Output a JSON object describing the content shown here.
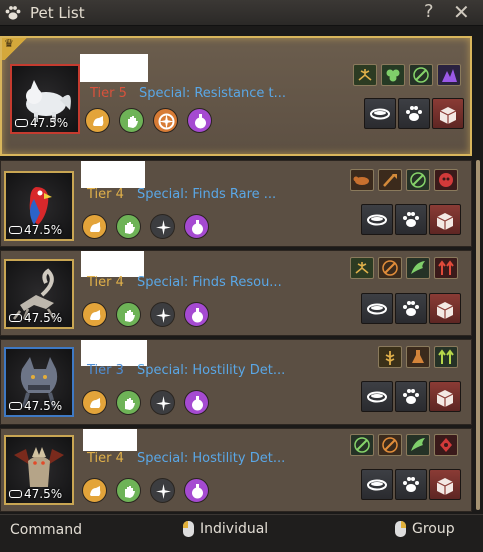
{
  "window": {
    "title": "Pet List",
    "help_glyph": "?",
    "close_glyph": "✕"
  },
  "colors": {
    "tier_gold": "#e0b04a",
    "tier_blue": "#4f8fd6",
    "tier_red": "#d8523c",
    "special_blue": "#5aa7e6"
  },
  "pets": [
    {
      "tier": "Tier 5",
      "tier_color": "#d8523c",
      "special": "Special: Resistance t...",
      "food": "47.5%",
      "frame": "red",
      "portrait": "white-fox-icon",
      "selected": true,
      "skills": [
        "scorpion-icon",
        "clover-icon",
        "pickaxe-icon",
        "purple-crystal-icon"
      ]
    },
    {
      "tier": "Tier 4",
      "tier_color": "#e0b04a",
      "special": "Special: Finds Rare ...",
      "food": "47.5%",
      "frame": "gold",
      "portrait": "red-parrot-icon",
      "selected": false,
      "skills": [
        "beast-icon",
        "shovel-icon",
        "pickaxe-icon",
        "red-skull-icon"
      ]
    },
    {
      "tier": "Tier 4",
      "tier_color": "#e0b04a",
      "special": "Special: Finds Resou...",
      "food": "47.5%",
      "frame": "gold",
      "portrait": "scorpion-pet-icon",
      "selected": false,
      "skills": [
        "scorpion-icon",
        "pickaxe-icon",
        "wing-icon",
        "red-arrows-icon"
      ]
    },
    {
      "tier": "Tier 3",
      "tier_color": "#4f8fd6",
      "special": "Special: Hostility Det...",
      "food": "47.5%",
      "frame": "blue",
      "portrait": "armored-wolf-icon",
      "selected": false,
      "skills": [
        "wheat-icon",
        "flask-icon",
        "green-arrows-icon"
      ]
    },
    {
      "tier": "Tier 4",
      "tier_color": "#e0b04a",
      "special": "Special: Hostility Det...",
      "food": "47.5%",
      "frame": "gold",
      "portrait": "dragon-pet-icon",
      "selected": false,
      "skills": [
        "pickaxe-icon",
        "pickaxe-icon",
        "wing-icon",
        "red-target-icon"
      ]
    }
  ],
  "bottom": {
    "command": "Command",
    "individual": "Individual",
    "group": "Group"
  }
}
